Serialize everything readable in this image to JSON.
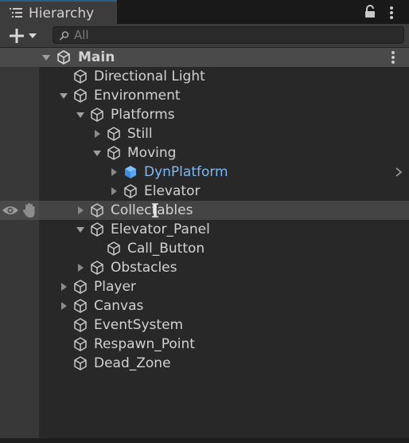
{
  "window": {
    "tab_title": "Hierarchy",
    "tab_icon": "list-icon",
    "lock_icon": "lock-icon",
    "menu_icon": "kebab-menu-icon"
  },
  "toolbar": {
    "add_icon": "plus-dropdown-icon",
    "search_placeholder": "All",
    "search_value": ""
  },
  "colors": {
    "accent": "#2c5d87",
    "selected_text": "#7db9f5",
    "selected_cube": "#4a9cf0",
    "text": "#d2d2d2"
  },
  "tree": {
    "scene": {
      "label": "Main",
      "icon": "unity-logo-icon",
      "expanded": true
    },
    "items": [
      {
        "label": "Directional Light",
        "depth": 0,
        "arrow": "none"
      },
      {
        "label": "Environment",
        "depth": 0,
        "arrow": "down"
      },
      {
        "label": "Platforms",
        "depth": 1,
        "arrow": "down"
      },
      {
        "label": "Still",
        "depth": 2,
        "arrow": "right"
      },
      {
        "label": "Moving",
        "depth": 2,
        "arrow": "down"
      },
      {
        "label": "DynPlatform",
        "depth": 3,
        "arrow": "right",
        "selected": true,
        "has_children_indicator": true
      },
      {
        "label": "Elevator",
        "depth": 3,
        "arrow": "right"
      },
      {
        "label": "Collectables",
        "depth": 1,
        "arrow": "right",
        "hovered": true
      },
      {
        "label": "Elevator_Panel",
        "depth": 1,
        "arrow": "down"
      },
      {
        "label": "Call_Button",
        "depth": 2,
        "arrow": "none"
      },
      {
        "label": "Obstacles",
        "depth": 1,
        "arrow": "right"
      },
      {
        "label": "Player",
        "depth": 0,
        "arrow": "right"
      },
      {
        "label": "Canvas",
        "depth": 0,
        "arrow": "right"
      },
      {
        "label": "EventSystem",
        "depth": 0,
        "arrow": "none"
      },
      {
        "label": "Respawn_Point",
        "depth": 0,
        "arrow": "none"
      },
      {
        "label": "Dead_Zone",
        "depth": 0,
        "arrow": "none"
      }
    ]
  }
}
